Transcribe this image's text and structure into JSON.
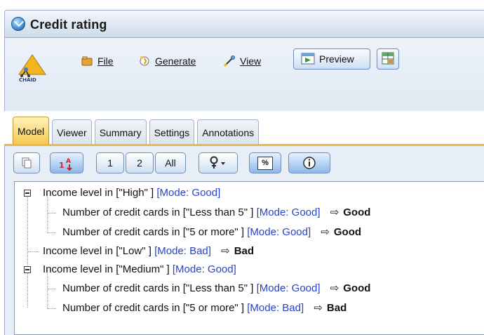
{
  "window": {
    "title": "Credit rating"
  },
  "node_icon_label": "CHAID",
  "menus": [
    {
      "label": "File",
      "icon": "file-folder-icon"
    },
    {
      "label": "Generate",
      "icon": "generate-icon"
    },
    {
      "label": "View",
      "icon": "view-icon"
    }
  ],
  "preview_button": {
    "label": "Preview"
  },
  "tabs": [
    {
      "label": "Model",
      "active": true
    },
    {
      "label": "Viewer",
      "active": false
    },
    {
      "label": "Summary",
      "active": false
    },
    {
      "label": "Settings",
      "active": false
    },
    {
      "label": "Annotations",
      "active": false
    }
  ],
  "panel_toolbar": {
    "copy_button": "copy-icon",
    "sort_button": "sort-icon",
    "depth_buttons": [
      "1",
      "2",
      "All"
    ],
    "pin_button": "pin-icon",
    "percent_button": "%",
    "info_button": "info-icon"
  },
  "tree": [
    {
      "text": "Income level in [\"High\" ]",
      "mode": "[Mode: Good]",
      "result": ""
    },
    {
      "text": "Number of credit cards in [\"Less than 5\" ]",
      "mode": "[Mode: Good]",
      "result": "Good"
    },
    {
      "text": "Number of credit cards in [\"5 or more\" ]",
      "mode": "[Mode: Good]",
      "result": "Good"
    },
    {
      "text": "Income level in [\"Low\" ]",
      "mode": "[Mode: Bad]",
      "result": "Bad"
    },
    {
      "text": "Income level in [\"Medium\" ]",
      "mode": "[Mode: Good]",
      "result": ""
    },
    {
      "text": "Number of credit cards in [\"Less than 5\" ]",
      "mode": "[Mode: Good]",
      "result": "Good"
    },
    {
      "text": "Number of credit cards in [\"5 or more\" ]",
      "mode": "[Mode: Bad]",
      "result": "Bad"
    }
  ],
  "colors": {
    "mode_text": "#2a43c7",
    "active_tab": "#f6c74e",
    "panel_bg": "#e8eef6"
  }
}
